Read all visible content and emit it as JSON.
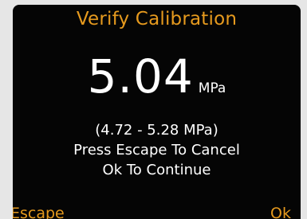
{
  "screen": {
    "title": "Verify Calibration",
    "reading": {
      "value": "5.04",
      "unit": "MPa"
    },
    "range_text": "(4.72 - 5.28 MPa)",
    "instruction_cancel": "Press Escape To Cancel",
    "instruction_continue": "Ok To Continue"
  },
  "softkeys": {
    "left_label": "Escape",
    "right_label": "Ok"
  },
  "colors": {
    "accent": "#e69a1e",
    "background": "#050505",
    "text": "#ffffff"
  }
}
